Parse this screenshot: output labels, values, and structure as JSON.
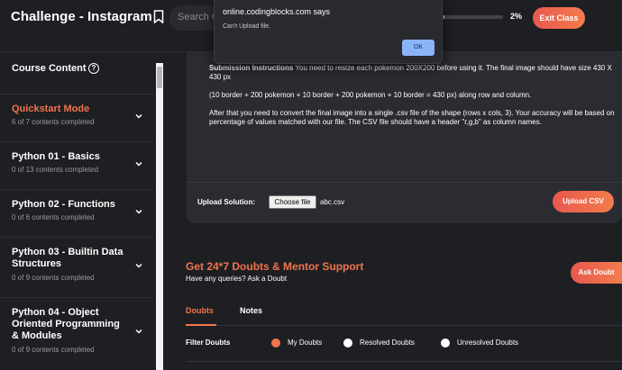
{
  "header": {
    "title": "Challenge - Instagram",
    "search_text": "Search C",
    "progress_percent": 2,
    "progress_label": "2%",
    "exit_label": "Exit Class"
  },
  "sidebar": {
    "title": "Course Content",
    "help_icon": "?",
    "modules": [
      {
        "name": "Quickstart Mode",
        "sub": "6 of 7 contents completed",
        "active": true
      },
      {
        "name": "Python 01 - Basics",
        "sub": "0 of 13 contents completed",
        "active": false
      },
      {
        "name": "Python 02 - Functions",
        "sub": "0 of 6 contents completed",
        "active": false
      },
      {
        "name": "Python 03 - Builtin Data Structures",
        "sub": "0 of 9 contents completed",
        "active": false
      },
      {
        "name": "Python 04 - Object Oriented Programming & Modules",
        "sub": "0 of 9 contents completed",
        "active": false
      }
    ]
  },
  "instructions": {
    "heading": "Submission Instructions",
    "p1": "You need to resize each pokemon 200X200 before using it. The final image should have size 430 X 430 px",
    "p2": "(10 border + 200 pokemon + 10 border + 200 pokemon + 10 border = 430 px) along row and column.",
    "p3": "After that you need to convert the final image into a single .csv file of the shape (rows x cols, 3). Your accuracy will be based on percentage of values matched with our file. The CSV file should have a header \"r,g,b\" as column names."
  },
  "upload": {
    "label": "Upload Solution:",
    "choose_file": "Choose file",
    "file_name": "abc.csv",
    "upload_button": "Upload CSV"
  },
  "doubts": {
    "title": "Get 24*7 Doubts & Mentor Support",
    "subtitle": "Have any queries? Ask a Doubt",
    "ask_button": "Ask Doubt",
    "tabs": [
      "Doubts",
      "Notes"
    ],
    "filter_label": "Filter Doubts",
    "filters": [
      "My Doubts",
      "Resolved Doubts",
      "Unresolved Doubts"
    ]
  },
  "dialog": {
    "title": "online.codingblocks.com says",
    "message": "Can't Upload file.",
    "ok": "OK"
  },
  "colors": {
    "accent": "#f0744d",
    "background": "#1e1f23",
    "card": "#2b2c31",
    "dialog_button": "#8ab4f8"
  },
  "icons": {
    "bookmark": "bookmark-icon",
    "help": "help-circle-icon",
    "chevron": "chevron-down-icon"
  }
}
